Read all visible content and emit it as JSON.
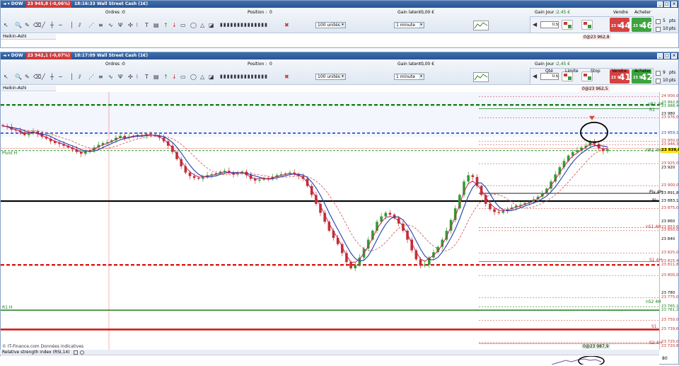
{
  "colors": {
    "bullish": "#2f9e2f",
    "bearish": "#c43030",
    "ma_fast": "#1f3fa8",
    "ma_slow": "#c8205a",
    "ma_dash": "#d05050",
    "resistance": "#1b7d1b",
    "support": "#d81818",
    "pivot": "#000000",
    "blue_level": "#2244cc"
  },
  "window1": {
    "title_arrow": "◄ ▾ DOW",
    "price_badge": "23 945,8 (-0,06%)",
    "time": "18:16:33",
    "instrument": "Wall Street Cash (1€)",
    "orders_label": "Ordres :",
    "orders_value": "0",
    "position_label": "Position :",
    "position_value": "0",
    "latent_label": "Gain latent :",
    "latent_value": "0,00 €",
    "day_label": "Gain Jour :",
    "day_value": "2,45 €",
    "qty_combo": "100 unités",
    "period_combo": "1 minute",
    "qty_input": "0.5",
    "stop_value": "0@23 962,8",
    "sell_label": "Vendre",
    "buy_label": "Acheter",
    "sell_price_small": "23 9",
    "sell_price_big": "44",
    "sell_price_dec": ",4",
    "buy_price_small": "23 9",
    "buy_price_big": "46",
    "buy_price_dec": ",1",
    "side_nums": [
      "5",
      "10"
    ],
    "side_labels": [
      "pts",
      "pts"
    ],
    "indicator_tab": "Heikin-Ashi"
  },
  "window2": {
    "title_arrow": "◄ ▾ DOW",
    "price_badge": "23 942,1 (-0,07%)",
    "time": "18:17:09",
    "instrument": "Wall Street Cash (1€)",
    "orders_label": "Ordres :",
    "orders_value": "0",
    "position_label": "Position :",
    "position_value": "0",
    "latent_label": "Gain latent :",
    "latent_value": "0,00 €",
    "day_label": "Gain Jour :",
    "day_value": "2,45 €",
    "qty_combo": "100 unités",
    "period_combo": "1 minute",
    "qty_header": "Qté",
    "limit_header": "Limite",
    "stop_header": "Stop",
    "qty_input": "0.5",
    "stop_value": "0@23 962,5",
    "sell_label": "Vendre",
    "buy_label": "Acheter",
    "sell_price_small": "23 9",
    "sell_price_big": "41",
    "sell_price_dec": ",1",
    "buy_price_small": "23 9",
    "buy_price_big": "42",
    "buy_price_dec": ",7",
    "side_nums": [
      "9",
      "10"
    ],
    "side_labels": [
      "pts",
      "pts"
    ],
    "indicator_tab": "Heikin-Ashi"
  },
  "chart": {
    "watermark": "© IT-Finance.com  Données indicatives",
    "bottom_stop": "0@23 987,9",
    "rsi_label": "Relative strength index (RSI,14)",
    "rsi_value": "80",
    "left_labels": {
      "r1h": "R1 H",
      "hc": "Pivot H"
    },
    "line_labels": {
      "r1": "R1",
      "r1_4h": "nR1 4H",
      "piv_4h": "Piv 4H",
      "piv": "Piv",
      "s1_4h_a": "nS1 4H",
      "s1_4h": "S1 4H",
      "s2_4h_a": "nS2 4H",
      "s1": "S1",
      "s2_4h": "S2 4H",
      "r1_4h_b": "nR1 4H"
    },
    "price_ticks": [
      {
        "v": "24 000,0",
        "c": "#c43030"
      },
      {
        "v": "23 992,8",
        "c": "#1b7d1b"
      },
      {
        "v": "23 988,4",
        "c": "#1b7d1b"
      },
      {
        "v": "23 980",
        "c": "#000"
      },
      {
        "v": "23 976,0",
        "c": "#c43030"
      },
      {
        "v": "23 959,1",
        "c": "#2244cc"
      },
      {
        "v": "23 950,0",
        "c": "#c43030"
      },
      {
        "v": "23 946,3",
        "c": "#c43030"
      },
      {
        "v": "23 940",
        "c": "#000"
      },
      {
        "v": "23 939,6",
        "c": "#000"
      },
      {
        "v": "23 925,0",
        "c": "#c43030"
      },
      {
        "v": "23 920",
        "c": "#000"
      },
      {
        "v": "23 900,0",
        "c": "#c43030"
      },
      {
        "v": "23 891,8",
        "c": "#000"
      },
      {
        "v": "23 883,1",
        "c": "#000"
      },
      {
        "v": "23 875,0",
        "c": "#c43030"
      },
      {
        "v": "23 860",
        "c": "#000"
      },
      {
        "v": "23 853,6",
        "c": "#c43030"
      },
      {
        "v": "23 850,0",
        "c": "#c43030"
      },
      {
        "v": "23 840",
        "c": "#000"
      },
      {
        "v": "23 825,0",
        "c": "#c43030"
      },
      {
        "v": "23 815,4",
        "c": "#c43030"
      },
      {
        "v": "23 811,8",
        "c": "#c43030"
      },
      {
        "v": "23 800,0",
        "c": "#c43030"
      },
      {
        "v": "23 780",
        "c": "#000"
      },
      {
        "v": "23 775,0",
        "c": "#c43030"
      },
      {
        "v": "23 765,1",
        "c": "#1b7d1b"
      },
      {
        "v": "23 761,2",
        "c": "#1b7d1b"
      },
      {
        "v": "23 750,0",
        "c": "#c43030"
      },
      {
        "v": "23 739,6",
        "c": "#c43030"
      },
      {
        "v": "23 725,0",
        "c": "#c43030"
      },
      {
        "v": "23 720,8",
        "c": "#c43030"
      }
    ],
    "highlight_price": "23 939,6",
    "series": {
      "close": [
        23967,
        23966,
        23963,
        23962,
        23960,
        23957,
        23959,
        23961,
        23958,
        23955,
        23953,
        23950,
        23948,
        23947,
        23945,
        23943,
        23941,
        23938,
        23936,
        23938,
        23940,
        23943,
        23946,
        23948,
        23949,
        23951,
        23954,
        23956,
        23954,
        23955,
        23956,
        23957,
        23956,
        23958,
        23957,
        23956,
        23954,
        23950,
        23945,
        23938,
        23930,
        23922,
        23915,
        23911,
        23909,
        23908,
        23910,
        23912,
        23913,
        23914,
        23916,
        23917,
        23915,
        23913,
        23914,
        23916,
        23912,
        23908,
        23906,
        23907,
        23909,
        23908,
        23910,
        23912,
        23913,
        23914,
        23915,
        23913,
        23911,
        23908,
        23900,
        23890,
        23880,
        23870,
        23860,
        23850,
        23842,
        23835,
        23825,
        23815,
        23808,
        23812,
        23820,
        23830,
        23840,
        23850,
        23860,
        23866,
        23870,
        23868,
        23864,
        23858,
        23850,
        23840,
        23828,
        23818,
        23811,
        23812,
        23820,
        23826,
        23832,
        23840,
        23850,
        23862,
        23875,
        23890,
        23905,
        23912,
        23910,
        23900,
        23890,
        23880,
        23874,
        23871,
        23870,
        23872,
        23874,
        23876,
        23878,
        23879,
        23881,
        23882,
        23885,
        23888,
        23892,
        23897,
        23905,
        23913,
        23921,
        23928,
        23934,
        23938,
        23940,
        23943,
        23945,
        23950,
        23947,
        23942,
        23939,
        23941
      ]
    }
  }
}
